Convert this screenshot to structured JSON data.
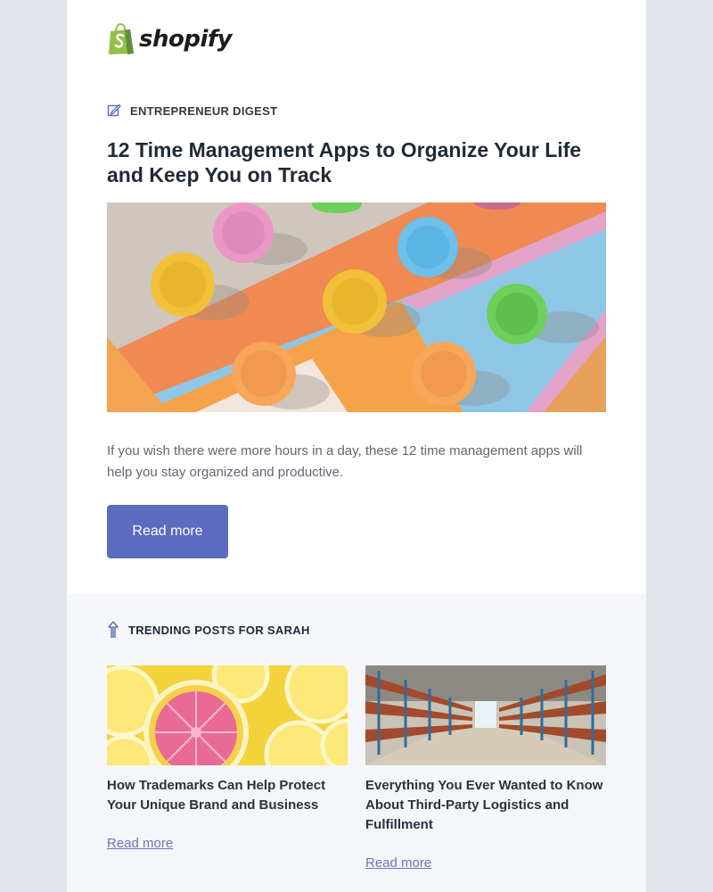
{
  "brand": {
    "name": "shopify",
    "logo_icon": "shopping-bag-icon",
    "color": "#95bf47"
  },
  "digest": {
    "label": "ENTREPRENEUR DIGEST",
    "icon": "edit-icon",
    "headline": "12 Time Management Apps to Organize Your Life and Keep You on Track",
    "description": "If you wish there were more hours in a day, these 12 time management apps will help you stay organized and productive.",
    "cta_label": "Read more",
    "accent_color": "#5b6bbf"
  },
  "trending": {
    "label": "TRENDING POSTS FOR SARAH",
    "icon": "trending-up-icon",
    "posts": [
      {
        "title": "How Trademarks Can Help Protect Your Unique Brand and Business",
        "link_label": "Read more"
      },
      {
        "title": "Everything You Ever Wanted to Know About Third-Party Logistics and Fulfillment",
        "link_label": "Read more"
      }
    ]
  }
}
